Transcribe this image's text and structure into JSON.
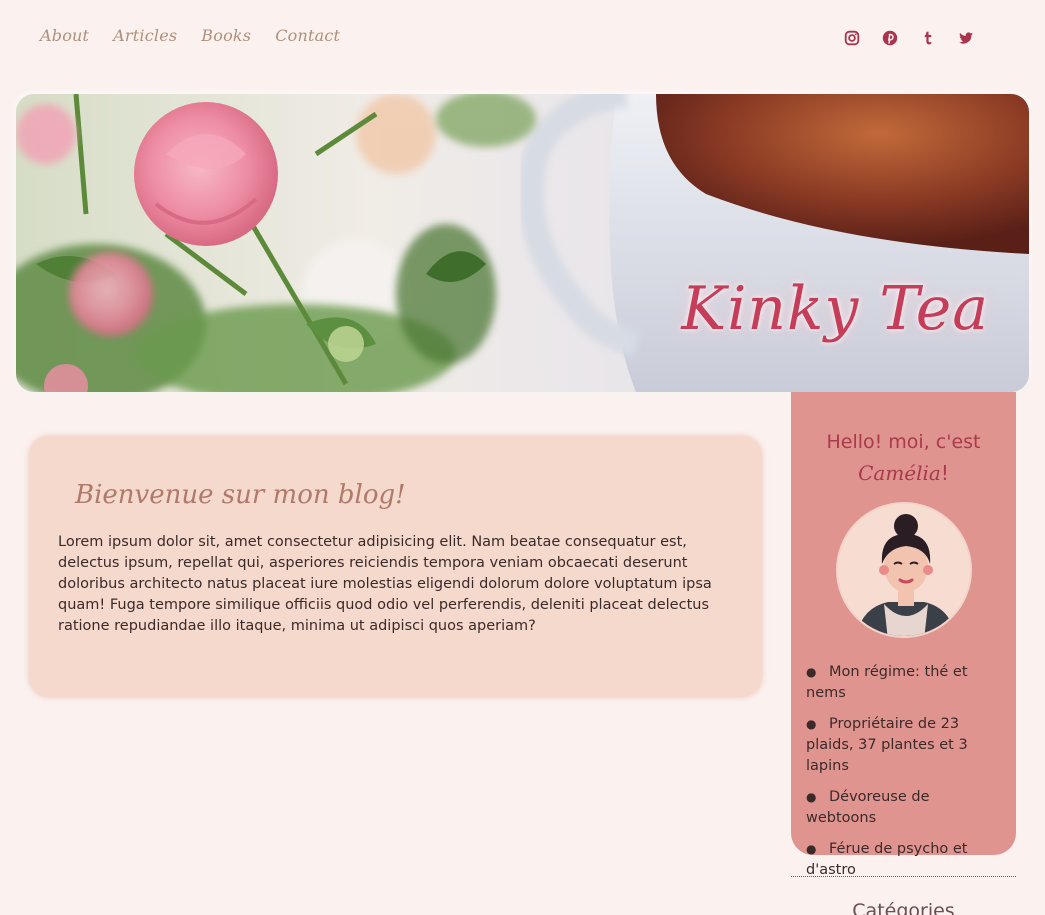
{
  "nav": {
    "items": [
      {
        "label": "About"
      },
      {
        "label": "Articles"
      },
      {
        "label": "Books"
      },
      {
        "label": "Contact"
      }
    ]
  },
  "social": {
    "icons": [
      "instagram-icon",
      "pinterest-icon",
      "tumblr-icon",
      "twitter-icon"
    ],
    "color": "#a8344d"
  },
  "hero": {
    "title": "Kinky Tea"
  },
  "main": {
    "heading": "Bienvenue sur mon blog!",
    "body": "Lorem ipsum dolor sit, amet consectetur adipisicing elit.  Nam beatae consequatur est, delectus ipsum, repellat qui, asperiores reiciendis tempora veniam obcaecati deserunt doloribus architecto natus placeat iure molestias eligendi dolorum dolore voluptatum ipsa quam!  Fuga tempore similique officiis quod odio vel perferendis, deleniti placeat delectus ratione repudiandae illo itaque, minima ut adipisci quos aperiam?"
  },
  "sidebar": {
    "hello": "Hello! moi, c'est",
    "name": "Camélia",
    "name_suffix": "!",
    "facts": [
      "Mon régime: thé et nems",
      "Propriétaire de 23 plaids, 37 plantes et 3 lapins",
      "Dévoreuse de webtoons",
      "Férue de psycho et d'astro"
    ],
    "categories_title": "Catégories"
  },
  "colors": {
    "background": "#fbf1ee",
    "card": "#f5d9cd",
    "sidebar": "#e0948f",
    "accent": "#c63d5a"
  }
}
